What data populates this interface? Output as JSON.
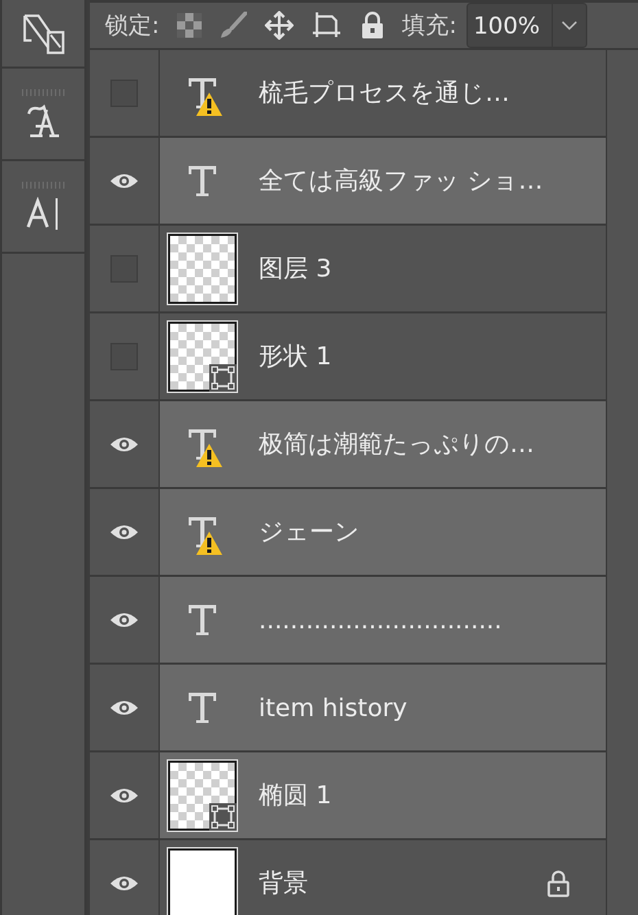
{
  "toolbar": {
    "lock_label": "锁定:",
    "fill_label": "填充:",
    "fill_value": "100%"
  },
  "layers": [
    {
      "kind": "text",
      "name": "梳毛プロセスを通じ…",
      "visible": false,
      "selected": false,
      "warning": true
    },
    {
      "kind": "text",
      "name": "全ては高級ファッ ショ…",
      "visible": true,
      "selected": true,
      "warning": false
    },
    {
      "kind": "raster",
      "name": "图层 3",
      "visible": false,
      "selected": false
    },
    {
      "kind": "shape",
      "name": "形状 1",
      "visible": false,
      "selected": false
    },
    {
      "kind": "text",
      "name": "极简は潮範たっぷりの…",
      "visible": true,
      "selected": true,
      "warning": true
    },
    {
      "kind": "text",
      "name": "ジェーン",
      "visible": true,
      "selected": true,
      "warning": true
    },
    {
      "kind": "text",
      "name": "...............................",
      "visible": true,
      "selected": true,
      "warning": false
    },
    {
      "kind": "text",
      "name": "item history",
      "visible": true,
      "selected": true,
      "warning": false
    },
    {
      "kind": "shape",
      "name": "椭圆 1",
      "visible": true,
      "selected": true
    },
    {
      "kind": "background",
      "name": "背景",
      "visible": true,
      "selected": false,
      "locked": true
    }
  ]
}
